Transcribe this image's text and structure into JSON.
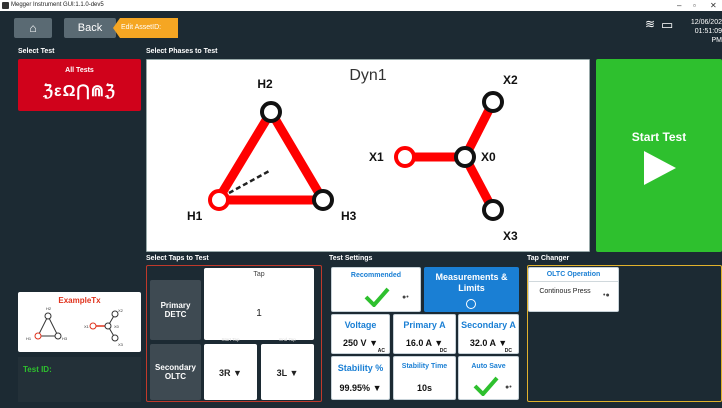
{
  "window": {
    "title": "Megger Instrument GUI:1.1.0-dev5",
    "minimize": "–",
    "maximize": "▫",
    "close": "✕"
  },
  "toolbar": {
    "home_icon": "home-icon",
    "back_label": "Back",
    "asset_label": "Edit AssetID: ExampleTx",
    "date": "12/06/202",
    "time": "01:51:09 PM"
  },
  "select_test": {
    "heading": "Select Test",
    "all_tests_label": "All Tests",
    "glyphs": "ℨεΩ⋂⋒ℨ"
  },
  "phases": {
    "heading": "Select Phases to Test",
    "vector_group": "Dyn1",
    "labels": {
      "h1": "H1",
      "h2": "H2",
      "h3": "H3",
      "x0": "X0",
      "x1": "X1",
      "x2": "X2",
      "x3": "X3"
    }
  },
  "start": {
    "label": "Start Test"
  },
  "asset": {
    "name": "ExampleTx",
    "mini_labels": [
      "H2",
      "H1",
      "H3",
      "X2",
      "X1",
      "X0",
      "X3"
    ]
  },
  "test_id": {
    "label": "Test ID:"
  },
  "taps": {
    "heading": "Select Taps to Test",
    "tap_header": "Tap",
    "primary_label": "Primary\nDETC",
    "primary_value": "1",
    "secondary_label": "Secondary\nOLTC",
    "start_tap_label": "Start Tap",
    "end_tap_label": "End Tap",
    "start_tap": "3R",
    "end_tap": "3L"
  },
  "settings": {
    "heading": "Test Settings",
    "recommended": "Recommended",
    "measurements": "Measurements & Limits",
    "voltage_label": "Voltage",
    "voltage_value": "250 V",
    "voltage_unit": "AC",
    "primary_a_label": "Primary A",
    "primary_a_value": "16.0 A",
    "primary_a_unit": "DC",
    "secondary_a_label": "Secondary A",
    "secondary_a_value": "32.0 A",
    "secondary_a_unit": "DC",
    "stability_label": "Stability %",
    "stability_value": "99.95%",
    "stability_time_label": "Stability Time",
    "stability_time_value": "10s",
    "auto_save_label": "Auto Save"
  },
  "tap_changer": {
    "heading": "Tap Changer",
    "oltc_label": "OLTC Operation",
    "oltc_value": "Continous Press"
  },
  "colors": {
    "red": "#d0021b",
    "green": "#2ec02e",
    "orange": "#f5a623",
    "blue": "#1a7fd4"
  }
}
